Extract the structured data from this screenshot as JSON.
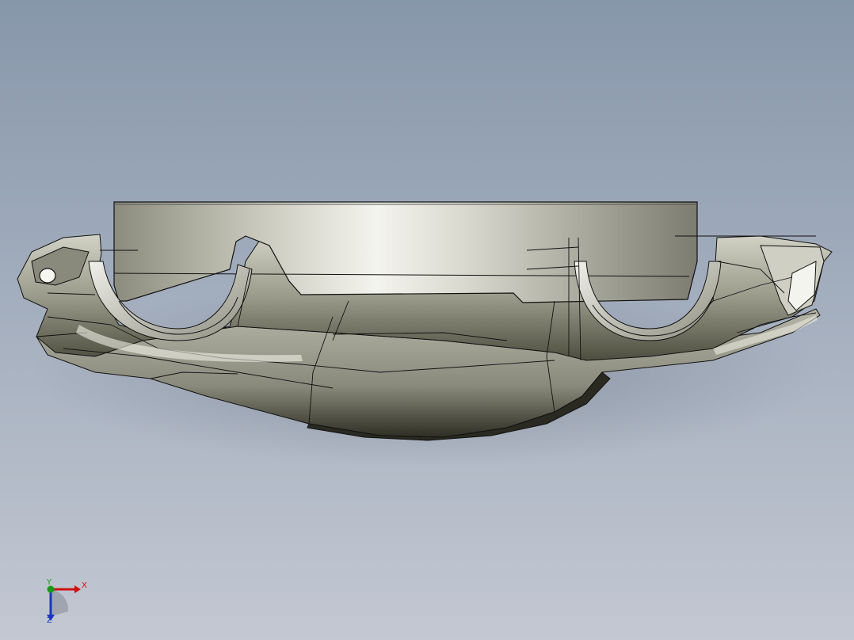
{
  "viewport": {
    "background_top": "#8797aa",
    "background_bottom": "#c3c8d2",
    "model": {
      "name": "front-bumper-part",
      "shade_light": "#e8e8de",
      "shade_mid": "#a9a998",
      "shade_dark": "#3a3a2e",
      "edge_color": "#111111"
    }
  },
  "triad": {
    "x_label": "X",
    "y_label": "Y",
    "z_label": "Z",
    "x_color": "#d01010",
    "y_color": "#1a9a1a",
    "z_color": "#1a36c0"
  }
}
